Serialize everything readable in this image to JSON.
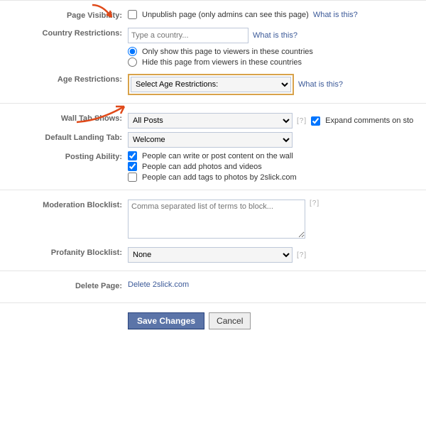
{
  "visibility": {
    "label": "Page Visibility:",
    "checkbox_label": "Unpublish page (only admins can see this page)",
    "checked": false,
    "help_link": "What is this?"
  },
  "country": {
    "label": "Country Restrictions:",
    "placeholder": "Type a country...",
    "help_link": "What is this?",
    "radio_show": "Only show this page to viewers in these countries",
    "radio_hide": "Hide this page from viewers in these countries",
    "selected": "show"
  },
  "age": {
    "label": "Age Restrictions:",
    "select_value": "Select Age Restrictions:",
    "help_link": "What is this?"
  },
  "wall_tab": {
    "label": "Wall Tab Shows:",
    "select_value": "All Posts",
    "help": "[?]",
    "expand_label": "Expand comments on sto",
    "expand_checked": true
  },
  "landing": {
    "label": "Default Landing Tab:",
    "select_value": "Welcome"
  },
  "posting": {
    "label": "Posting Ability:",
    "opt1": {
      "label": "People can write or post content on the wall",
      "checked": true
    },
    "opt2": {
      "label": "People can add photos and videos",
      "checked": true
    },
    "opt3": {
      "label": "People can add tags to photos by 2slick.com",
      "checked": false
    }
  },
  "moderation": {
    "label": "Moderation Blocklist:",
    "placeholder": "Comma separated list of terms to block...",
    "help": "[?]"
  },
  "profanity": {
    "label": "Profanity Blocklist:",
    "select_value": "None",
    "help": "[?]"
  },
  "delete": {
    "label": "Delete Page:",
    "link_text": "Delete 2slick.com"
  },
  "buttons": {
    "save": "Save Changes",
    "cancel": "Cancel"
  }
}
